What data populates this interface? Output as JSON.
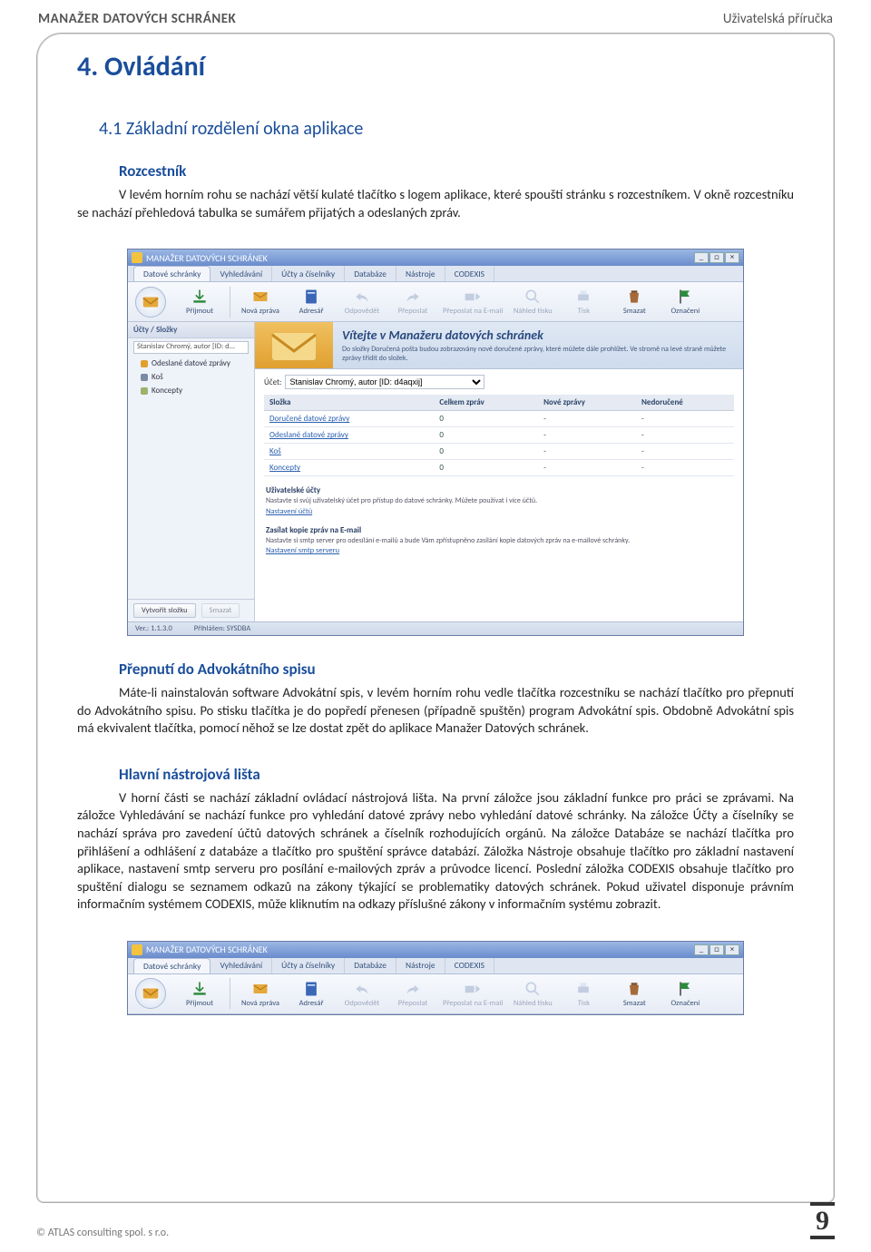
{
  "header": {
    "left": "MANAŽER DATOVÝCH SCHRÁNEK",
    "right": "Uživatelská příručka"
  },
  "chapter": "4. Ovládání",
  "section": "4.1 Základní rozdělení okna aplikace",
  "sub1": {
    "title": "Rozcestník",
    "para": "V levém horním rohu se nachází větší kulaté tlačítko s logem aplikace, které spouští stránku s rozcestníkem. V okně rozcestníku se nachází přehledová tabulka se sumářem přijatých a odeslaných zpráv."
  },
  "sub2": {
    "title": "Přepnutí do Advokátního spisu",
    "para": "Máte-li nainstalován software Advokátní spis, v levém horním rohu vedle tlačítka rozcestníku se nachází tlačítko pro přepnutí do Advokátního spisu. Po stisku tlačítka je do popředí přenesen (případně spuštěn) program Advokátní spis. Obdobně Advokátní spis má ekvivalent tlačítka, pomocí něhož se lze dostat zpět do aplikace Manažer Datových schránek."
  },
  "sub3": {
    "title": "Hlavní nástrojová lišta",
    "para": "V horní části se nachází základní ovládací nástrojová lišta. Na první záložce jsou základní funkce pro práci se zprávami. Na záložce Vyhledávání se nachází funkce pro vyhledání datové zprávy nebo vyhledání datové schránky. Na záložce Účty a číselníky se nachází správa pro zavedení účtů datových schránek a číselník rozhodujících orgánů. Na záložce Databáze se nachází tlačítka pro přihlášení a odhlášení z databáze a tlačítko pro spuštění správce databází. Záložka Nástroje obsahuje tlačítko pro základní nastavení aplikace, nastavení smtp serveru pro posílání e-mailových zpráv a průvodce licencí. Poslední záložka CODEXIS obsahuje tlačítko pro spuštění dialogu se seznamem odkazů na zákony týkající se problematiky datových schránek. Pokud uživatel disponuje právním informačním systémem CODEXIS, může kliknutím na odkazy příslušné zákony v informačním systému zobrazit."
  },
  "screenshot": {
    "title": "MANAŽER DATOVÝCH SCHRÁNEK",
    "tabs": [
      "Datové schránky",
      "Vyhledávání",
      "Účty a číselníky",
      "Databáze",
      "Nástroje",
      "CODEXIS"
    ],
    "toolbar": [
      {
        "label": "Přijmout",
        "icon": "download-icon",
        "color": "#2e8b3d"
      },
      {
        "label": "Nová zpráva",
        "icon": "mail-icon",
        "color": "#d08a1e"
      },
      {
        "label": "Adresář",
        "icon": "book-icon",
        "color": "#3a66b6"
      },
      {
        "label": "Odpovědět",
        "icon": "reply-icon",
        "color": "#8aa0c2"
      },
      {
        "label": "Přeposlat",
        "icon": "forward-icon",
        "color": "#8aa0c2"
      },
      {
        "label": "Přeposlat na E-mail",
        "icon": "forward-mail-icon",
        "color": "#8aa0c2"
      },
      {
        "label": "Náhled tisku",
        "icon": "preview-icon",
        "color": "#8aa0c2"
      },
      {
        "label": "Tisk",
        "icon": "print-icon",
        "color": "#8aa0c2"
      },
      {
        "label": "Smazat",
        "icon": "trash-icon",
        "color": "#a56a3a"
      },
      {
        "label": "Označení",
        "icon": "flag-icon",
        "color": "#2e8b3d"
      }
    ],
    "sidebar": {
      "title": "Účty / Složky",
      "combo": "Stanislav Chromý, autor [ID: d...",
      "items": [
        {
          "label": "Odeslané datové zprávy",
          "color": "#e0a030"
        },
        {
          "label": "Koš",
          "color": "#7a8aa6"
        },
        {
          "label": "Koncepty",
          "color": "#9ab26a"
        }
      ],
      "buttons": {
        "create": "Vytvořit složku",
        "delete": "Smazat"
      }
    },
    "welcome": {
      "heading": "Vítejte v Manažeru datových schránek",
      "subtext": "Do složky Doručená pošta budou zobrazovány nově doručené zprávy, které můžete dále prohlížet. Ve stromě na levé straně můžete zprávy třídit do složek.",
      "account_label": "Účet:",
      "account_value": "Stanislav Chromý, autor [ID: d4aqxij]"
    },
    "table": {
      "headers": [
        "Složka",
        "Celkem zpráv",
        "Nové zprávy",
        "Nedoručené"
      ],
      "rows": [
        [
          "Doručené datové zprávy",
          "0",
          "-",
          "-"
        ],
        [
          "Odeslané datové zprávy",
          "0",
          "-",
          "-"
        ],
        [
          "Koš",
          "0",
          "-",
          "-"
        ],
        [
          "Koncepty",
          "0",
          "-",
          "-"
        ]
      ]
    },
    "panels": [
      {
        "title": "Uživatelské účty",
        "text": "Nastavte si svůj uživatelský účet pro přístup do datové schránky. Můžete používat i více účtů.",
        "link": "Nastavení účtů"
      },
      {
        "title": "Zasílat kopie zpráv na E-mail",
        "text": "Nastavte si smtp server pro odesílání e-mailů a bude Vám zpřístupněno zasílání kopie datových zpráv na e-mailové schránky.",
        "link": "Nastavení smtp serveru"
      }
    ],
    "status": {
      "ver": "Ver.: 1.1.3.0",
      "login": "Přihlášen: SYSDBA"
    }
  },
  "footer": {
    "copyright": "© ATLAS consulting spol. s r.o.",
    "page": "9"
  }
}
